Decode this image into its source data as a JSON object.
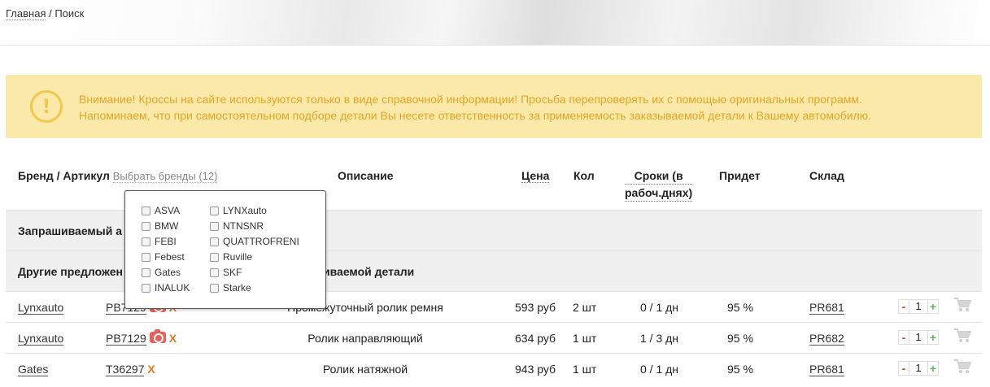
{
  "breadcrumb": {
    "home": "Главная",
    "separator": " / ",
    "current": "Поиск"
  },
  "notice": {
    "line1": "Внимание! Кроссы на сайте используются только в виде справочной информации! Просьба перепроверять их с помощью оригинальных программ.",
    "line2": "Напоминаем, что при самостоятельном подборе детали Вы несете ответственность за применяемость заказываемой детали к Вашему автомобилю.",
    "icon": "exclamation-circle-icon"
  },
  "table": {
    "headers": {
      "brand": "Бренд / Артикул",
      "brand_filter": "Выбрать бренды (12)",
      "description": "Описание",
      "price": "Цена",
      "qty": "Кол",
      "terms_line1": "Сроки (в",
      "terms_line2": "рабоч.днях)",
      "arrival": "Придет",
      "warehouse": "Склад"
    },
    "sections": {
      "requested": "Запрашиваемый а",
      "others_left": "Другие предложен",
      "others_right": "иваемой детали"
    },
    "rows": [
      {
        "brand": "Lynxauto",
        "article": "PB7129",
        "remove": "X",
        "description": "Промежуточный ролик ремня",
        "price": "593 руб",
        "qty": "2 шт",
        "terms": "0 / 1 дн",
        "arrival": "95 %",
        "warehouse": "PR681",
        "amount": "1",
        "minus": "-",
        "plus": "+"
      },
      {
        "brand": "Lynxauto",
        "article": "PB7129",
        "remove": "X",
        "description": "Ролик направляющий",
        "price": "634 руб",
        "qty": "1 шт",
        "terms": "1 / 3 дн",
        "arrival": "95 %",
        "warehouse": "PR682",
        "amount": "1",
        "minus": "-",
        "plus": "+"
      },
      {
        "brand": "Gates",
        "article": "T36297",
        "remove": "X",
        "description": "Ролик натяжной",
        "price": "943 руб",
        "qty": "1 шт",
        "terms": "0 / 1 дн",
        "arrival": "95 %",
        "warehouse": "PR681",
        "amount": "1",
        "minus": "-",
        "plus": "+"
      }
    ]
  },
  "brand_dropdown": {
    "col1": [
      "ASVA",
      "BMW",
      "FEBI",
      "Febest",
      "Gates",
      "INALUK"
    ],
    "col2": [
      "LYNXauto",
      "NTNSNR",
      "QUATTROFRENI",
      "Ruville",
      "SKF",
      "Starke"
    ]
  },
  "colors": {
    "notice_bg": "#fbe9a9",
    "notice_text": "#e2a524",
    "remove_x": "#e07b22",
    "camera": "#e8605c",
    "minus": "#d53a3a",
    "plus": "#5cb85c"
  }
}
